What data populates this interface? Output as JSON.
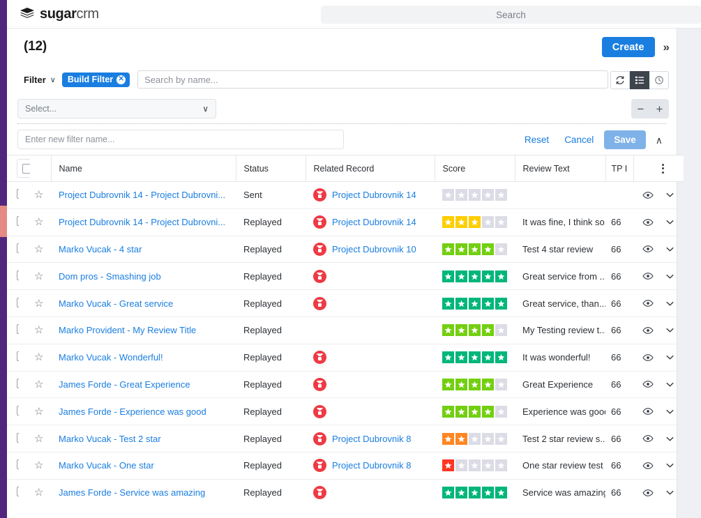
{
  "navbar": {
    "brand_bold": "sugar",
    "brand_light": "crm",
    "search_placeholder": "Search",
    "search_value": ""
  },
  "titlebar": {
    "record_count": "(12)",
    "create_label": "Create",
    "more_icon": "»"
  },
  "filterbar": {
    "filter_label": "Filter",
    "filter_caret": "∨",
    "pill_label": "Build Filter",
    "pill_close": "✕",
    "search_placeholder": "Search by name...",
    "search_value": "",
    "refresh_icon": "refresh-icon",
    "list_icon": "list-view-icon",
    "clock_icon": "recently-viewed-icon"
  },
  "build_filter": {
    "select_placeholder": "Select...",
    "select_caret": "∨",
    "minus_label": "−",
    "plus_label": "+",
    "name_placeholder": "Enter new filter name...",
    "name_value": "",
    "reset_label": "Reset",
    "cancel_label": "Cancel",
    "save_label": "Save",
    "collapse_icon": "∧"
  },
  "table": {
    "columns": [
      {
        "key": "name",
        "label": "Name"
      },
      {
        "key": "status",
        "label": "Status"
      },
      {
        "key": "rel",
        "label": "Related Record"
      },
      {
        "key": "score",
        "label": "Score"
      },
      {
        "key": "review",
        "label": "Review Text"
      },
      {
        "key": "tp",
        "label": "TP I"
      }
    ],
    "header_caret": "∨",
    "rows": [
      {
        "name": "Project Dubrovnik 14 - Project Dubrovni...",
        "status": "Sent",
        "related": "Project Dubrovnik 14",
        "has_related_icon": true,
        "score": 0,
        "review": "",
        "tp": ""
      },
      {
        "name": "Project Dubrovnik 14 - Project Dubrovni...",
        "status": "Replayed",
        "related": "Project Dubrovnik 14",
        "has_related_icon": true,
        "score": 3,
        "review": "It was fine, I think so.",
        "tp": "66 "
      },
      {
        "name": "Marko Vucak - 4 star",
        "status": "Replayed",
        "related": "Project Dubrovnik 10",
        "has_related_icon": true,
        "score": 4,
        "review": "Test 4 star review",
        "tp": "66 "
      },
      {
        "name": "Dom pros - Smashing job",
        "status": "Replayed",
        "related": "",
        "has_related_icon": true,
        "score": 5,
        "review": "Great service from ...",
        "tp": "66 "
      },
      {
        "name": "Marko Vucak - Great service",
        "status": "Replayed",
        "related": "",
        "has_related_icon": true,
        "score": 5,
        "review": "Great service, than...",
        "tp": "66 "
      },
      {
        "name": "Marko Provident - My Review Title",
        "status": "Replayed",
        "related": "",
        "has_related_icon": false,
        "score": 4,
        "review": "My Testing review t...",
        "tp": "66 "
      },
      {
        "name": "Marko Vucak - Wonderful!",
        "status": "Replayed",
        "related": "",
        "has_related_icon": true,
        "score": 5,
        "review": "It was wonderful!",
        "tp": "66 "
      },
      {
        "name": "James Forde - Great Experience",
        "status": "Replayed",
        "related": "",
        "has_related_icon": true,
        "score": 4,
        "review": "Great Experience",
        "tp": "66 "
      },
      {
        "name": "James Forde - Experience was good",
        "status": "Replayed",
        "related": "",
        "has_related_icon": true,
        "score": 4,
        "review": "Experience was good",
        "tp": "66 "
      },
      {
        "name": "Marko Vucak - Test 2 star",
        "status": "Replayed",
        "related": "Project Dubrovnik 8",
        "has_related_icon": true,
        "score": 2,
        "review": "Test 2 star review s...",
        "tp": "66 "
      },
      {
        "name": "Marko Vucak - One star",
        "status": "Replayed",
        "related": "Project Dubrovnik 8",
        "has_related_icon": true,
        "score": 1,
        "review": "One star review test",
        "tp": "66 "
      },
      {
        "name": "James Forde - Service was amazing",
        "status": "Replayed",
        "related": "",
        "has_related_icon": true,
        "score": 5,
        "review": "Service was amazing",
        "tp": "66 "
      }
    ]
  },
  "colors": {
    "accent_blue": "#1a7ee0",
    "rail_purple": "#51267d",
    "rail_accent": "#e38b84",
    "star_empty": "#dcdce6",
    "star_1": "#ff3722",
    "star_2": "#ff8622",
    "star_3": "#ffce00",
    "star_4": "#73cf11",
    "star_5": "#00b67a",
    "tp_red": "#ee3a44"
  }
}
